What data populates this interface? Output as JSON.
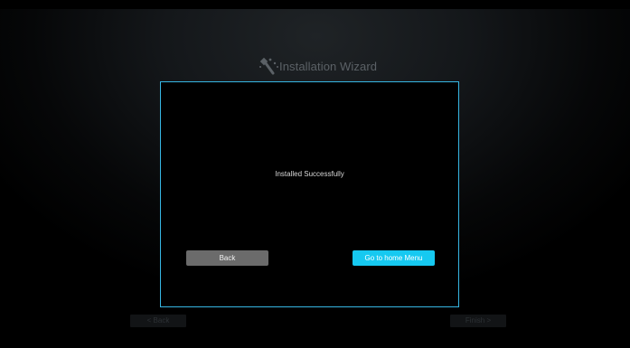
{
  "wizard": {
    "title": "Installation Wizard",
    "icon": "magic-wand-icon"
  },
  "background_nav": {
    "back_label": "< Back",
    "finish_label": "Finish >"
  },
  "dialog": {
    "message": "Installed Successfully",
    "back_label": "Back",
    "home_label": "Go to home Menu"
  },
  "colors": {
    "accent": "#16c9f1",
    "dialog_border": "#36b6e3",
    "secondary_button": "#6b6b6b",
    "background": "#000000"
  }
}
